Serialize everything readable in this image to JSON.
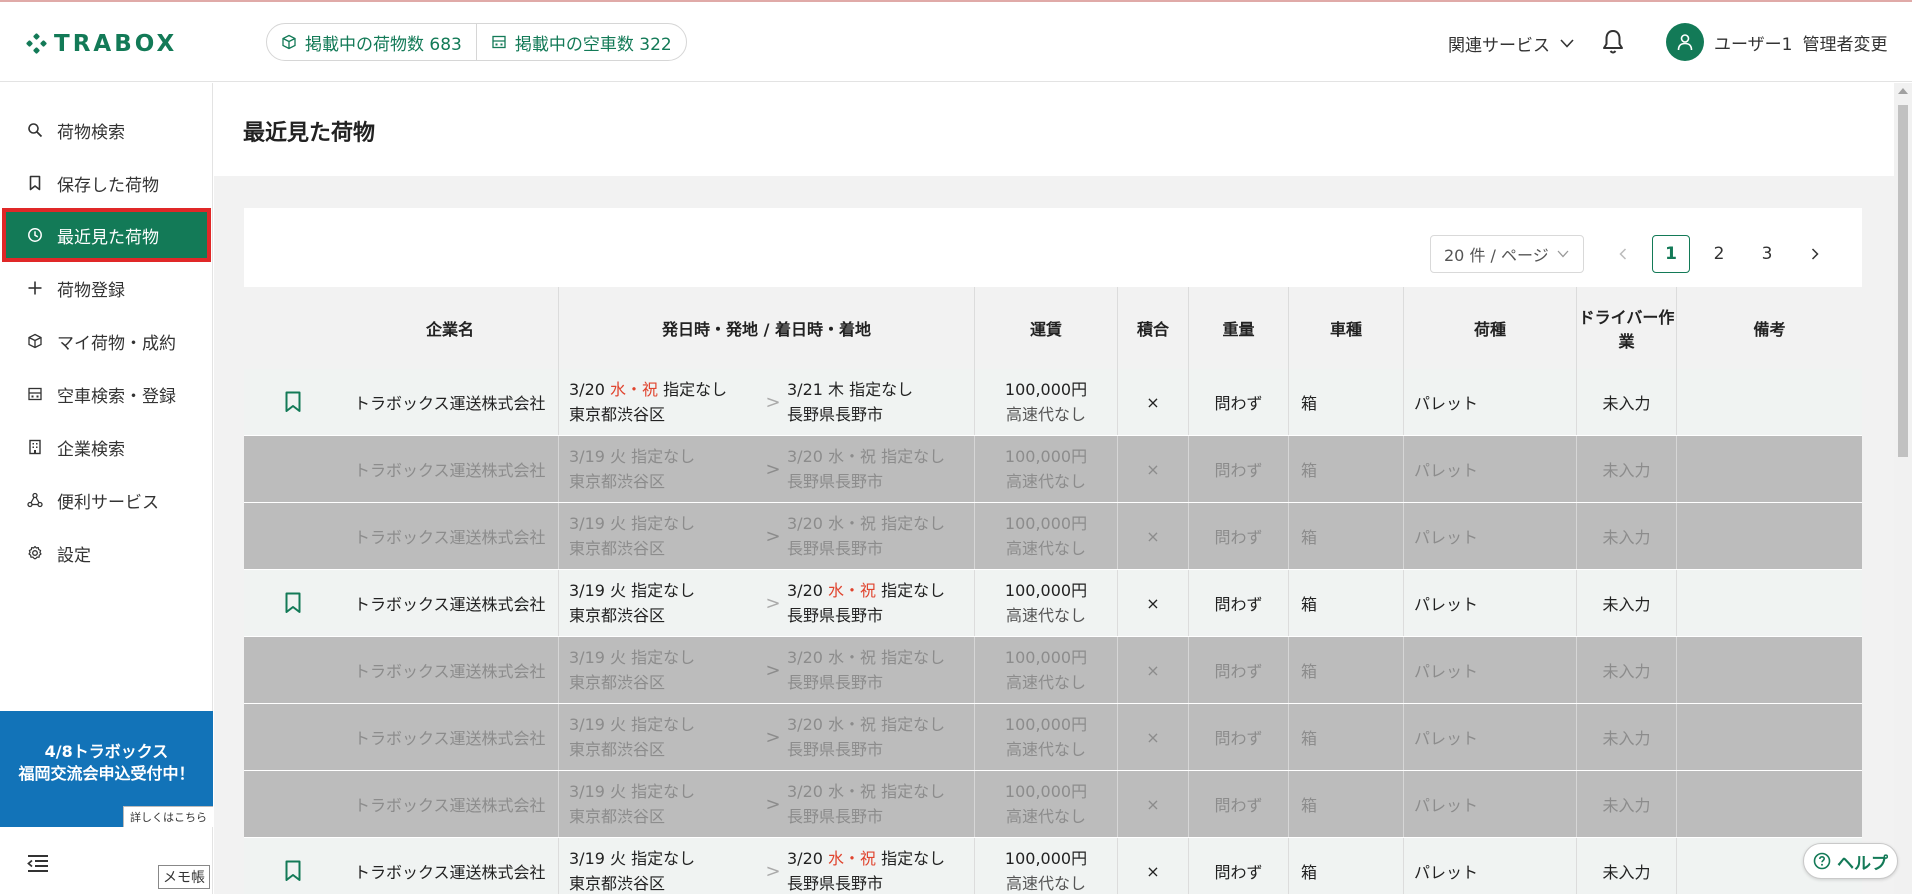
{
  "header": {
    "logo": "TRABOX",
    "cargo_count_label": "掲載中の荷物数 683",
    "vehicle_count_label": "掲載中の空車数 322",
    "related_services": "関連サービス",
    "user_name": "ユーザー1",
    "admin_change": "管理者変更"
  },
  "sidebar": {
    "items": [
      {
        "label": "荷物検索",
        "icon": "search-icon"
      },
      {
        "label": "保存した荷物",
        "icon": "bookmark-icon"
      },
      {
        "label": "最近見た荷物",
        "icon": "clock-icon",
        "active": true
      },
      {
        "label": "荷物登録",
        "icon": "plus-icon"
      },
      {
        "label": "マイ荷物・成約",
        "icon": "box-icon"
      },
      {
        "label": "空車検索・登録",
        "icon": "truck-icon"
      },
      {
        "label": "企業検索",
        "icon": "building-icon"
      },
      {
        "label": "便利サービス",
        "icon": "network-icon"
      },
      {
        "label": "設定",
        "icon": "gear-icon"
      }
    ],
    "banner_line1": "4/8トラボックス",
    "banner_line2": "福岡交流会申込受付中！",
    "banner_link": "詳しくはこちら",
    "memo": "メモ帳"
  },
  "main": {
    "title": "最近見た荷物",
    "pager": {
      "per_page": "20 件 / ページ",
      "pages": [
        "1",
        "2",
        "3"
      ],
      "current": "1"
    },
    "columns": [
      "企業名",
      "発日時・発地 / 着日時・着地",
      "運賃",
      "積合",
      "重量",
      "車種",
      "荷種",
      "ドライバー作業",
      "備考"
    ],
    "rows": [
      {
        "state": "vis",
        "bookmarked": true,
        "company": "トラボックス運送株式会社",
        "dep_date": "3/20",
        "dep_day": "水・祝",
        "dep_time": "指定なし",
        "dep_place": "東京都渋谷区",
        "arr_date": "3/21",
        "arr_day": "木",
        "arr_time": "指定なし",
        "arr_place": "長野県長野市",
        "fare": "100,000円",
        "toll": "高速代なし",
        "mix": "×",
        "weight": "問わず",
        "vehicle": "箱",
        "cargo": "パレット",
        "driver": "未入力",
        "note": ""
      },
      {
        "state": "dim",
        "bookmarked": false,
        "company": "トラボックス運送株式会社",
        "dep_date": "3/19",
        "dep_day": "火",
        "dep_time": "指定なし",
        "dep_place": "東京都渋谷区",
        "arr_date": "3/20",
        "arr_day": "水・祝",
        "arr_time": "指定なし",
        "arr_place": "長野県長野市",
        "fare": "100,000円",
        "toll": "高速代なし",
        "mix": "×",
        "weight": "問わず",
        "vehicle": "箱",
        "cargo": "パレット",
        "driver": "未入力",
        "note": ""
      },
      {
        "state": "dim",
        "bookmarked": false,
        "company": "トラボックス運送株式会社",
        "dep_date": "3/19",
        "dep_day": "火",
        "dep_time": "指定なし",
        "dep_place": "東京都渋谷区",
        "arr_date": "3/20",
        "arr_day": "水・祝",
        "arr_time": "指定なし",
        "arr_place": "長野県長野市",
        "fare": "100,000円",
        "toll": "高速代なし",
        "mix": "×",
        "weight": "問わず",
        "vehicle": "箱",
        "cargo": "パレット",
        "driver": "未入力",
        "note": ""
      },
      {
        "state": "vis",
        "bookmarked": true,
        "company": "トラボックス運送株式会社",
        "dep_date": "3/19",
        "dep_day": "火",
        "dep_time": "指定なし",
        "dep_place": "東京都渋谷区",
        "arr_date": "3/20",
        "arr_day": "水・祝",
        "arr_time": "指定なし",
        "arr_place": "長野県長野市",
        "fare": "100,000円",
        "toll": "高速代なし",
        "mix": "×",
        "weight": "問わず",
        "vehicle": "箱",
        "cargo": "パレット",
        "driver": "未入力",
        "note": ""
      },
      {
        "state": "dim",
        "bookmarked": false,
        "company": "トラボックス運送株式会社",
        "dep_date": "3/19",
        "dep_day": "火",
        "dep_time": "指定なし",
        "dep_place": "東京都渋谷区",
        "arr_date": "3/20",
        "arr_day": "水・祝",
        "arr_time": "指定なし",
        "arr_place": "長野県長野市",
        "fare": "100,000円",
        "toll": "高速代なし",
        "mix": "×",
        "weight": "問わず",
        "vehicle": "箱",
        "cargo": "パレット",
        "driver": "未入力",
        "note": ""
      },
      {
        "state": "dim",
        "bookmarked": false,
        "company": "トラボックス運送株式会社",
        "dep_date": "3/19",
        "dep_day": "火",
        "dep_time": "指定なし",
        "dep_place": "東京都渋谷区",
        "arr_date": "3/20",
        "arr_day": "水・祝",
        "arr_time": "指定なし",
        "arr_place": "長野県長野市",
        "fare": "100,000円",
        "toll": "高速代なし",
        "mix": "×",
        "weight": "問わず",
        "vehicle": "箱",
        "cargo": "パレット",
        "driver": "未入力",
        "note": ""
      },
      {
        "state": "dim",
        "bookmarked": false,
        "company": "トラボックス運送株式会社",
        "dep_date": "3/19",
        "dep_day": "火",
        "dep_time": "指定なし",
        "dep_place": "東京都渋谷区",
        "arr_date": "3/20",
        "arr_day": "水・祝",
        "arr_time": "指定なし",
        "arr_place": "長野県長野市",
        "fare": "100,000円",
        "toll": "高速代なし",
        "mix": "×",
        "weight": "問わず",
        "vehicle": "箱",
        "cargo": "パレット",
        "driver": "未入力",
        "note": ""
      },
      {
        "state": "vis",
        "bookmarked": true,
        "company": "トラボックス運送株式会社",
        "dep_date": "3/19",
        "dep_day": "火",
        "dep_time": "指定なし",
        "dep_place": "東京都渋谷区",
        "arr_date": "3/20",
        "arr_day": "水・祝",
        "arr_time": "指定なし",
        "arr_place": "長野県長野市",
        "fare": "100,000円",
        "toll": "高速代なし",
        "mix": "×",
        "weight": "問わず",
        "vehicle": "箱",
        "cargo": "パレット",
        "driver": "未入力",
        "note": ""
      }
    ]
  },
  "help": "ヘルプ",
  "colors": {
    "brand": "#137a57",
    "holiday": "#e0442e",
    "highlight": "#e02828",
    "banner": "#1273b8"
  }
}
